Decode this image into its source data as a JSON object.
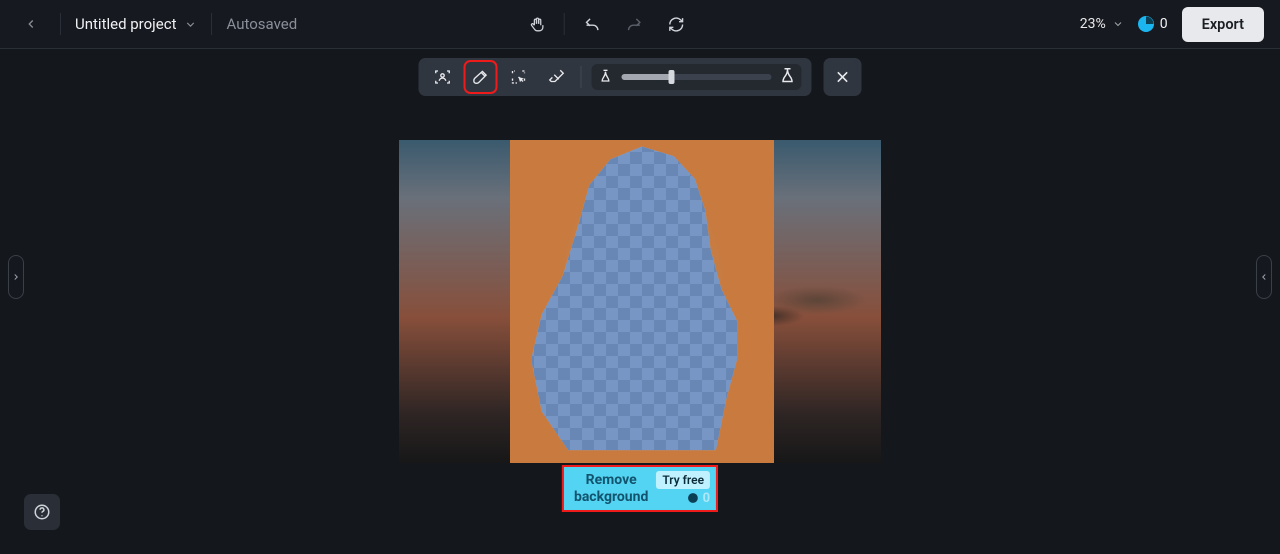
{
  "header": {
    "project_name": "Untitled project",
    "status": "Autosaved",
    "zoom": "23%",
    "credits": "0",
    "export_label": "Export"
  },
  "toolbar": {
    "slider_value_pct": 33
  },
  "callout": {
    "line1": "Remove",
    "line2": "background",
    "try_free": "Try free",
    "credit_tail": "0"
  }
}
